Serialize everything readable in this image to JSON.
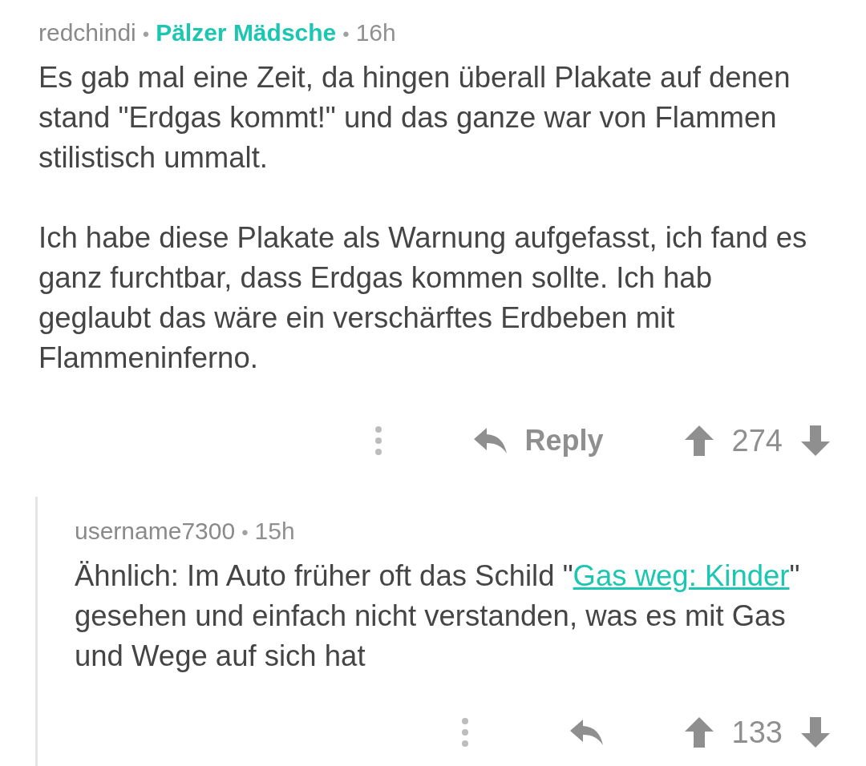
{
  "comments": [
    {
      "meta": [
        {
          "kind": "author",
          "text": "redchindi"
        },
        {
          "kind": "separator",
          "text": "•"
        },
        {
          "kind": "flair",
          "text": "Pälzer Mädsche"
        },
        {
          "kind": "separator",
          "text": "•"
        },
        {
          "kind": "age",
          "text": "16h"
        }
      ],
      "paragraphs": [
        [
          {
            "kind": "text",
            "text": "Es gab mal eine Zeit, da hingen überall Plakate auf denen stand \"Erdgas kommt!\" und das ganze war von Flammen stilistisch ummalt."
          }
        ],
        [
          {
            "kind": "text",
            "text": "Ich habe diese Plakate als Warnung aufgefasst, ich fand es ganz furchtbar, dass Erdgas kommen sollte. Ich hab geglaubt das wäre ein verschärftes Erdbeben mit Flammeninferno."
          }
        ]
      ],
      "reply_label": "Reply",
      "score": "274",
      "children": [
        {
          "meta": [
            {
              "kind": "author",
              "text": "username7300"
            },
            {
              "kind": "separator",
              "text": "•"
            },
            {
              "kind": "age",
              "text": "15h"
            }
          ],
          "paragraphs": [
            [
              {
                "kind": "text",
                "text": "Ähnlich: Im Auto früher oft das Schild \""
              },
              {
                "kind": "link",
                "text": "Gas weg: Kinder"
              },
              {
                "kind": "text",
                "text": "\" gesehen und einfach nicht verstanden, was es mit Gas und Wege auf sich hat"
              }
            ]
          ],
          "score": "133"
        }
      ]
    }
  ]
}
